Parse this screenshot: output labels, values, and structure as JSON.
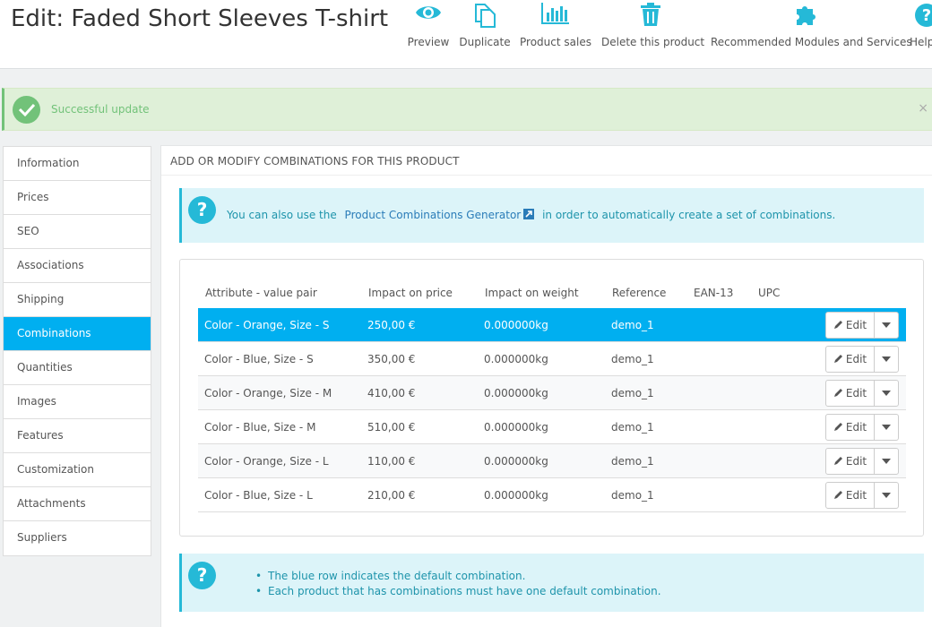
{
  "header": {
    "title": "Edit: Faded Short Sleeves T-shirt",
    "actions": [
      {
        "label": "Preview",
        "icon": "eye-icon"
      },
      {
        "label": "Duplicate",
        "icon": "copy-icon"
      },
      {
        "label": "Product sales",
        "icon": "bar-chart-icon"
      },
      {
        "label": "Delete this product",
        "icon": "trash-icon"
      },
      {
        "label": "Recommended Modules and Services",
        "icon": "puzzle-icon"
      },
      {
        "label": "Help",
        "icon": "help-icon"
      }
    ]
  },
  "alert": {
    "message": "Successful update",
    "close": "×"
  },
  "tabs": [
    {
      "label": "Information"
    },
    {
      "label": "Prices"
    },
    {
      "label": "SEO"
    },
    {
      "label": "Associations"
    },
    {
      "label": "Shipping"
    },
    {
      "label": "Combinations",
      "active": true
    },
    {
      "label": "Quantities"
    },
    {
      "label": "Images"
    },
    {
      "label": "Features"
    },
    {
      "label": "Customization"
    },
    {
      "label": "Attachments"
    },
    {
      "label": "Suppliers"
    }
  ],
  "panel": {
    "heading": "ADD OR MODIFY COMBINATIONS FOR THIS PRODUCT",
    "info_before": "You can also use the",
    "info_link": "Product Combinations Generator",
    "info_after": "in order to automatically create a set of combinations.",
    "notes": [
      "The blue row indicates the default combination.",
      "Each product that has combinations must have one default combination."
    ]
  },
  "table": {
    "columns": [
      "Attribute - value pair",
      "Impact on price",
      "Impact on weight",
      "Reference",
      "EAN-13",
      "UPC"
    ],
    "edit_label": "Edit",
    "rows": [
      {
        "attribute": "Color - Orange, Size - S",
        "price": "250,00 €",
        "weight": "0.000000kg",
        "reference": "demo_1",
        "ean13": "",
        "upc": "",
        "default": true
      },
      {
        "attribute": "Color - Blue, Size - S",
        "price": "350,00 €",
        "weight": "0.000000kg",
        "reference": "demo_1",
        "ean13": "",
        "upc": ""
      },
      {
        "attribute": "Color - Orange, Size - M",
        "price": "410,00 €",
        "weight": "0.000000kg",
        "reference": "demo_1",
        "ean13": "",
        "upc": ""
      },
      {
        "attribute": "Color - Blue, Size - M",
        "price": "510,00 €",
        "weight": "0.000000kg",
        "reference": "demo_1",
        "ean13": "",
        "upc": ""
      },
      {
        "attribute": "Color - Orange, Size - L",
        "price": "110,00 €",
        "weight": "0.000000kg",
        "reference": "demo_1",
        "ean13": "",
        "upc": ""
      },
      {
        "attribute": "Color - Blue, Size - L",
        "price": "210,00 €",
        "weight": "0.000000kg",
        "reference": "demo_1",
        "ean13": "",
        "upc": ""
      }
    ]
  },
  "colors": {
    "accent": "#00aff0",
    "icon": "#25b9d7",
    "success": "#72c279"
  }
}
